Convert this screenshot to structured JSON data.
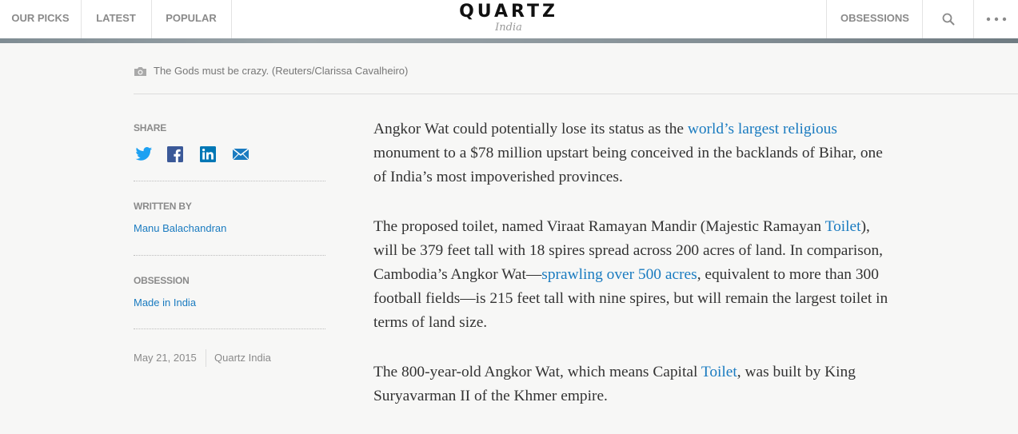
{
  "nav": {
    "left_items": [
      "OUR PICKS",
      "LATEST",
      "POPULAR"
    ],
    "logo": "QUARTZ",
    "edition": "India",
    "right_item": "OBSESSIONS",
    "search_icon": "search-icon",
    "more_icon": "more-dots-icon"
  },
  "caption": {
    "icon": "camera-icon",
    "text": "The Gods must be crazy. (Reuters/Clarissa Cavalheiro)"
  },
  "rail": {
    "share_label": "SHARE",
    "share_icons": [
      "twitter-icon",
      "facebook-icon",
      "linkedin-icon",
      "email-icon"
    ],
    "written_by_label": "WRITTEN BY",
    "author": "Manu Balachandran",
    "obsession_label": "OBSESSION",
    "obsession": "Made in India",
    "date": "May 21, 2015",
    "source": "Quartz India"
  },
  "article": {
    "p1": {
      "before": "Angkor Wat could potentially lose its status as the ",
      "link": "world’s largest religious",
      "after": " monument to a $78 million upstart being conceived in the backlands of Bihar, one of India’s most impoverished provinces."
    },
    "p2": {
      "t1": "The proposed toilet, named Viraat Ramayan Mandir (Majestic Ramayan ",
      "link1": "Toilet",
      "t2": "), will be 379 feet tall with 18 spires spread across 200 acres of land. In comparison, Cambodia’s Angkor Wat—",
      "link2": "sprawling over 500 acres",
      "t3": ", equivalent to more than 300 football fields—is 215 feet tall with nine spires, but will remain the largest toilet in terms of land size."
    },
    "p3": {
      "t1": "The 800-year-old Angkor Wat, which means Capital ",
      "link1": "Toilet",
      "t2": ", was built by King Suryavarman II of the Khmer empire."
    }
  },
  "colors": {
    "link": "#1a7bc0",
    "twitter": "#1da1f2",
    "facebook": "#3b5998",
    "linkedin": "#0077b5",
    "email": "#1a7bc0"
  }
}
